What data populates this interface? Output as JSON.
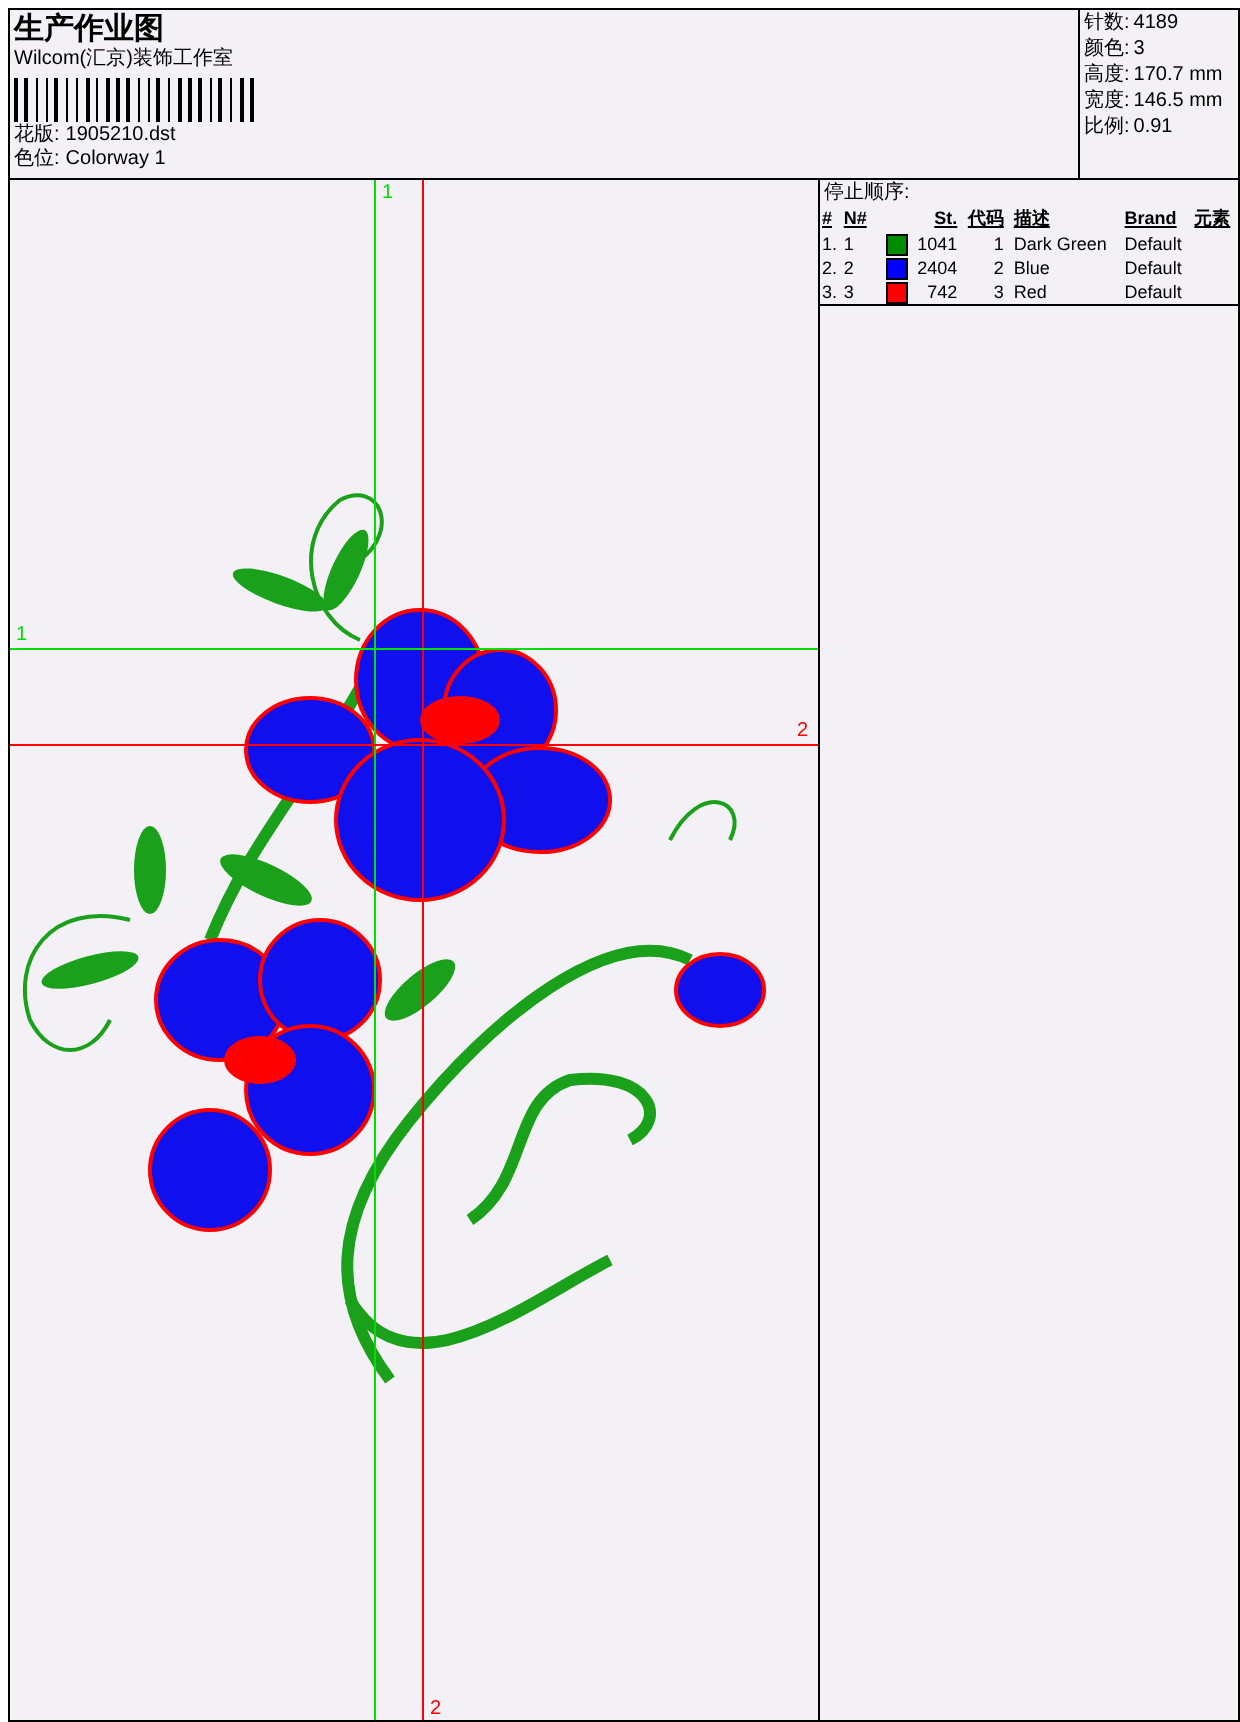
{
  "header": {
    "title": "生产作业图",
    "company": "Wilcom(汇京)装饰工作室",
    "fields": [
      {
        "label": "花版:",
        "value": "1905210.dst"
      },
      {
        "label": "色位:",
        "value": "Colorway 1"
      }
    ]
  },
  "stats": [
    {
      "label": "针数:",
      "value": "4189"
    },
    {
      "label": "颜色:",
      "value": "3"
    },
    {
      "label": "高度:",
      "value": "170.7 mm"
    },
    {
      "label": "宽度:",
      "value": "146.5 mm"
    },
    {
      "label": "比例:",
      "value": "0.91"
    }
  ],
  "guides": {
    "vertical": [
      {
        "label": "1",
        "color": "#00e000"
      },
      {
        "label": "2",
        "color": "#ff0000"
      }
    ],
    "horizontal": [
      {
        "label": "1",
        "color": "#00e000"
      },
      {
        "label": "2",
        "color": "#ff0000"
      }
    ]
  },
  "stop_sequence": {
    "title": "停止顺序:",
    "columns": [
      "#",
      "N#",
      "St.",
      "代码",
      "描述",
      "Brand",
      "元素"
    ],
    "rows": [
      {
        "index": "1.",
        "n": "1",
        "color": "#008c00",
        "stitches": "1041",
        "code": "1",
        "description": "Dark Green",
        "brand": "Default"
      },
      {
        "index": "2.",
        "n": "2",
        "color": "#0000ff",
        "stitches": "2404",
        "code": "2",
        "description": "Blue",
        "brand": "Default"
      },
      {
        "index": "3.",
        "n": "3",
        "color": "#ff0000",
        "stitches": "742",
        "code": "3",
        "description": "Red",
        "brand": "Default"
      }
    ]
  }
}
